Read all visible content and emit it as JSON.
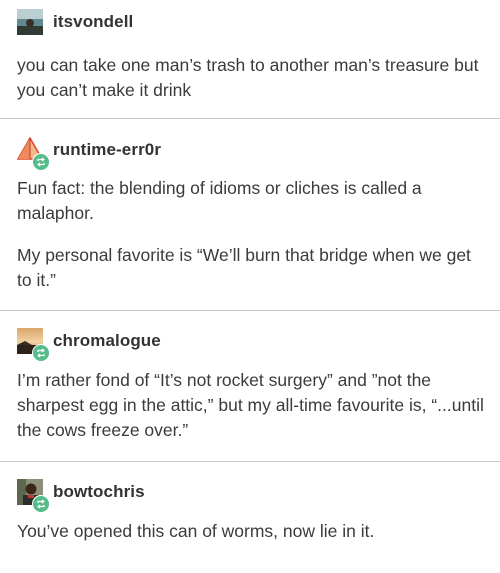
{
  "posts": [
    {
      "username": "itsvondell",
      "avatar_icon": "avatar-landscape-photo",
      "reblog": false,
      "paragraphs": [
        "you can take one man’s trash to another man’s treasure but you can’t make it drink"
      ]
    },
    {
      "username": "runtime-err0r",
      "avatar_icon": "avatar-pyramid-shape",
      "reblog": true,
      "paragraphs": [
        "Fun fact: the blending of idioms or cliches is called a malaphor.",
        "My personal favorite is “We’ll burn that bridge when we get to it.”"
      ]
    },
    {
      "username": "chromalogue",
      "avatar_icon": "avatar-sunset-photo",
      "reblog": true,
      "paragraphs": [
        "I’m rather fond of “It’s not rocket surgery” and ”not the sharpest egg in the attic,” but my all-time favourite is, “...until the cows freeze over.”"
      ]
    },
    {
      "username": "bowtochris",
      "avatar_icon": "avatar-person-photo",
      "reblog": true,
      "paragraphs": [
        "You’ve opened this can of worms, now lie in it."
      ]
    }
  ],
  "colors": {
    "text": "#3b3b3b",
    "username": "#333333",
    "divider": "#c8c8c8",
    "reblog_badge": "#56bc8a"
  }
}
